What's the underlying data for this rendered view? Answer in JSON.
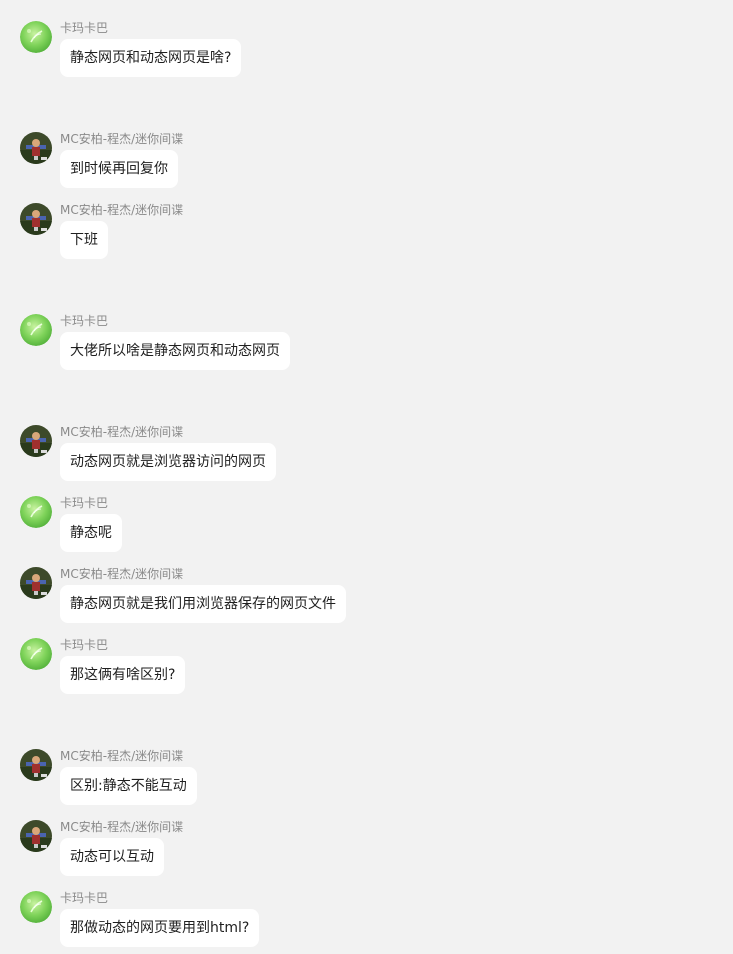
{
  "messages": [
    {
      "sender": "卡玛卡巴",
      "avatar_icon": "green-leaf-avatar-icon",
      "text": "静态网页和动态网页是啥?"
    },
    {
      "sender": "MC安柏-程杰/迷你间谍",
      "avatar_icon": "person-photo-avatar-icon",
      "text": "到时候再回复你"
    },
    {
      "sender": "MC安柏-程杰/迷你间谍",
      "avatar_icon": "person-photo-avatar-icon",
      "text": "下班"
    },
    {
      "sender": "卡玛卡巴",
      "avatar_icon": "green-leaf-avatar-icon",
      "text": "大佬所以啥是静态网页和动态网页"
    },
    {
      "sender": "MC安柏-程杰/迷你间谍",
      "avatar_icon": "person-photo-avatar-icon",
      "text": "动态网页就是浏览器访问的网页"
    },
    {
      "sender": "卡玛卡巴",
      "avatar_icon": "green-leaf-avatar-icon",
      "text": "静态呢"
    },
    {
      "sender": "MC安柏-程杰/迷你间谍",
      "avatar_icon": "person-photo-avatar-icon",
      "text": "静态网页就是我们用浏览器保存的网页文件"
    },
    {
      "sender": "卡玛卡巴",
      "avatar_icon": "green-leaf-avatar-icon",
      "text": "那这俩有啥区别?"
    },
    {
      "sender": "MC安柏-程杰/迷你间谍",
      "avatar_icon": "person-photo-avatar-icon",
      "text": "区别:静态不能互动"
    },
    {
      "sender": "MC安柏-程杰/迷你间谍",
      "avatar_icon": "person-photo-avatar-icon",
      "text": "动态可以互动"
    },
    {
      "sender": "卡玛卡巴",
      "avatar_icon": "green-leaf-avatar-icon",
      "text": "那做动态的网页要用到html?"
    }
  ]
}
